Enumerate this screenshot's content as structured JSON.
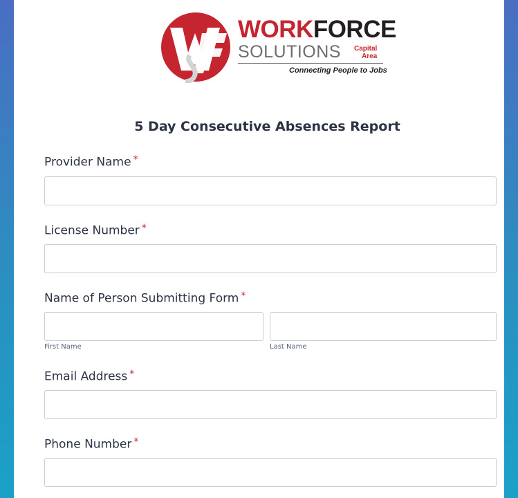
{
  "logo": {
    "word_work": "WORK",
    "word_force": "FORCE",
    "solutions": "SOLUTIONS",
    "capital": "Capital",
    "area": "Area",
    "tagline": "Connecting People to Jobs",
    "monogram": "WF",
    "brand_red": "#c5252e",
    "brand_gray": "#6d6e71"
  },
  "form": {
    "title": "5 Day Consecutive Absences Report",
    "required_marker": "*",
    "fields": {
      "provider_name": {
        "label": "Provider Name",
        "value": ""
      },
      "license_number": {
        "label": "License Number",
        "value": ""
      },
      "submitter_name": {
        "label": "Name of Person Submitting Form",
        "first_sublabel": "First Name",
        "last_sublabel": "Last Name",
        "first_value": "",
        "last_value": ""
      },
      "email": {
        "label": "Email Address",
        "value": ""
      },
      "phone": {
        "label": "Phone Number",
        "value": ""
      }
    }
  },
  "colors": {
    "side_gradient_top": "#4a6ec2",
    "side_gradient_bottom": "#1aa1c7",
    "text": "#2c3345",
    "required": "#c5252e",
    "input_border": "#c8ccd6"
  }
}
